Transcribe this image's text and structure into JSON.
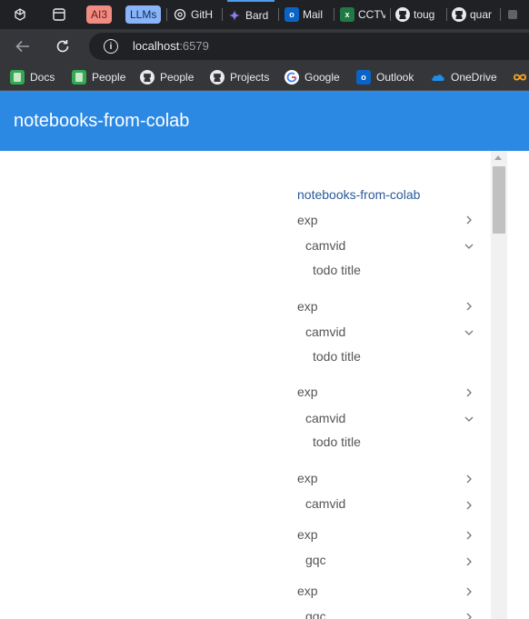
{
  "browser": {
    "tabs": [
      {
        "label": "AI3",
        "style": "red-pill"
      },
      {
        "label": "LLMs",
        "style": "blue-pill"
      },
      {
        "label": "GitH",
        "icon": "chatgpt-icon"
      },
      {
        "label": "Bard",
        "icon": "bard-sparkle-icon"
      },
      {
        "label": "Mail",
        "icon": "outlook-icon"
      },
      {
        "label": "CCTV",
        "icon": "excel-icon"
      },
      {
        "label": "toug",
        "icon": "github-icon"
      },
      {
        "label": "quar",
        "icon": "github-icon"
      }
    ],
    "excel_letter": "x",
    "outlook_letter": "o",
    "address": {
      "host": "localhost",
      "port": ":6579"
    },
    "bookmarks": [
      {
        "label": "Docs",
        "icon": "green-book-icon"
      },
      {
        "label": "People",
        "icon": "green-book-icon"
      },
      {
        "label": "People",
        "icon": "github-icon"
      },
      {
        "label": "Projects",
        "icon": "github-icon"
      },
      {
        "label": "Google",
        "icon": "google-icon"
      },
      {
        "label": "Outlook",
        "icon": "outlook-icon"
      },
      {
        "label": "OneDrive",
        "icon": "onedrive-icon"
      }
    ],
    "colors": {
      "chrome_dark": "#202124",
      "chrome_toolbar": "#35363a",
      "pill_red": "#f28b82",
      "pill_blue": "#8ab4f8"
    }
  },
  "app": {
    "title": "notebooks-from-colab",
    "header_color": "#2b89e4"
  },
  "nav": {
    "root": "notebooks-from-colab",
    "items": [
      {
        "label": "exp",
        "level": 1,
        "state": "collapsed"
      },
      {
        "label": "camvid",
        "level": 2,
        "state": "expanded"
      },
      {
        "label": "todo title",
        "level": 3
      },
      {
        "label": "exp",
        "level": 1,
        "state": "collapsed"
      },
      {
        "label": "camvid",
        "level": 2,
        "state": "expanded"
      },
      {
        "label": "todo title",
        "level": 3
      },
      {
        "label": "exp",
        "level": 1,
        "state": "collapsed"
      },
      {
        "label": "camvid",
        "level": 2,
        "state": "expanded"
      },
      {
        "label": "todo title",
        "level": 3
      },
      {
        "label": "exp",
        "level": 1,
        "state": "collapsed"
      },
      {
        "label": "camvid",
        "level": 2,
        "state": "collapsed"
      },
      {
        "label": "exp",
        "level": 1,
        "state": "collapsed"
      },
      {
        "label": "gqc",
        "level": 2,
        "state": "collapsed"
      },
      {
        "label": "exp",
        "level": 1,
        "state": "collapsed"
      },
      {
        "label": "gqc",
        "level": 2,
        "state": "collapsed"
      }
    ]
  }
}
